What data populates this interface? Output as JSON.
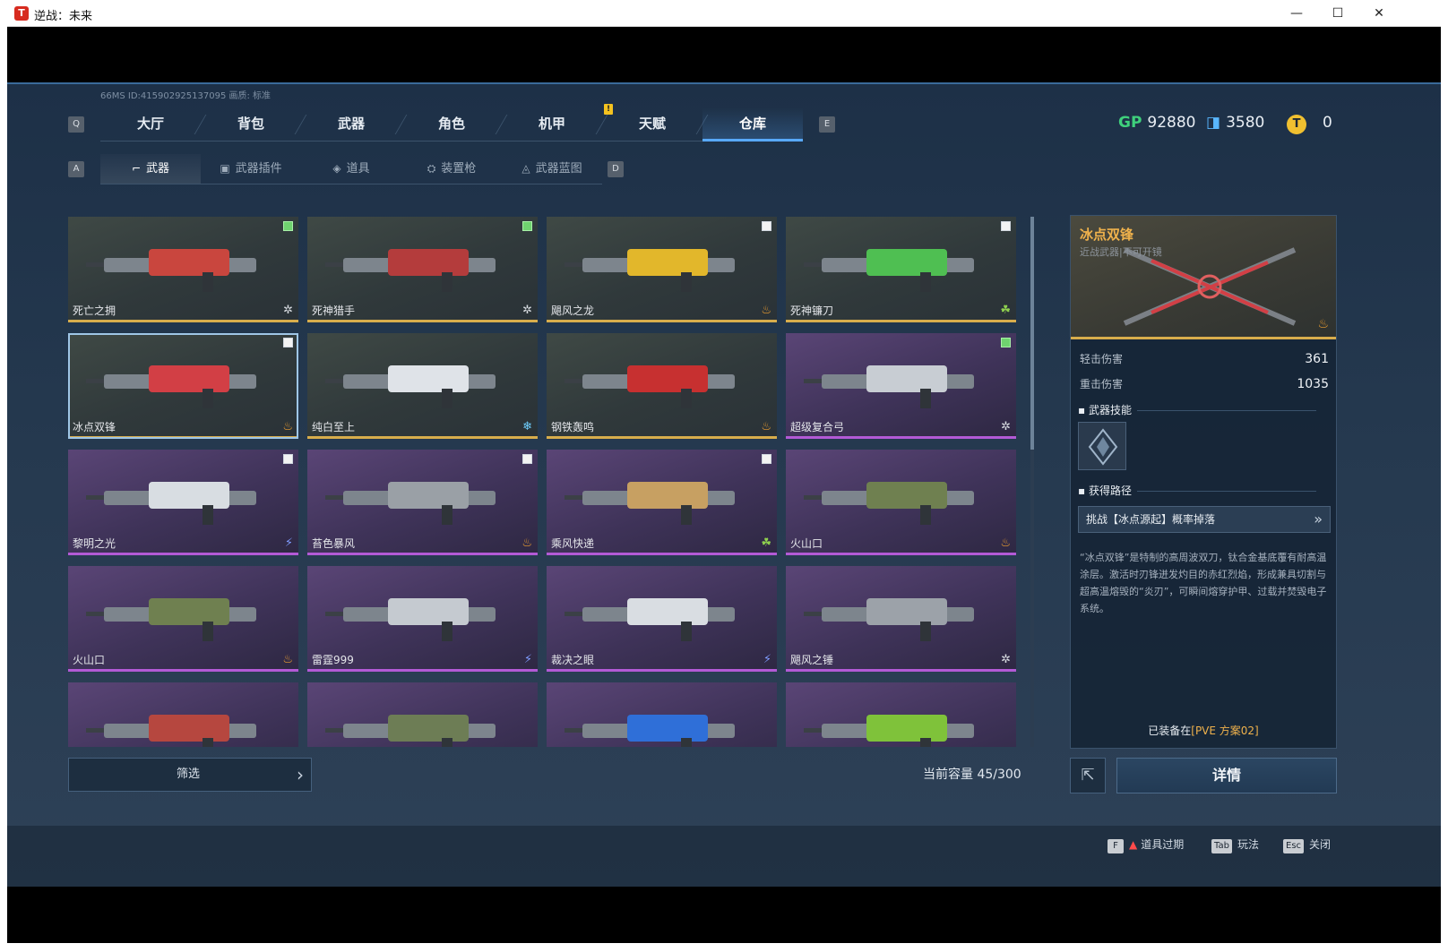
{
  "window": {
    "title": "逆战：未来",
    "app_icon": "T",
    "controls": [
      "—",
      "☐",
      "✕"
    ]
  },
  "info_line": "66MS  ID:415902925137095    画质: 标准",
  "keys": {
    "q": "Q",
    "e": "E",
    "a": "A",
    "d": "D"
  },
  "top_nav": {
    "items": [
      "大厅",
      "背包",
      "武器",
      "角色",
      "机甲",
      "天赋",
      "仓库"
    ],
    "active": "仓库",
    "badge": "!"
  },
  "sub_nav": {
    "items": [
      {
        "icon": "rifle-icon",
        "glyph": "⌐",
        "label": "武器"
      },
      {
        "icon": "plugin-icon",
        "glyph": "▣",
        "label": "武器插件"
      },
      {
        "icon": "item-icon",
        "glyph": "◈",
        "label": "道具"
      },
      {
        "icon": "turret-icon",
        "glyph": "⛭",
        "label": "装置枪"
      },
      {
        "icon": "blueprint-icon",
        "glyph": "◬",
        "label": "武器蓝图"
      }
    ],
    "active": "武器"
  },
  "currencies": [
    {
      "icon": "gp-icon",
      "symbol": "GP",
      "value": "92880",
      "color": "#3fd07c"
    },
    {
      "icon": "ticket-icon",
      "symbol": "◨",
      "value": "3580",
      "color": "#59b7ff"
    },
    {
      "icon": "coin-icon",
      "symbol": "T",
      "value": "0",
      "color": "#f0c030"
    }
  ],
  "weapons": [
    {
      "name": "死亡之拥",
      "rarity": "gold",
      "type_icon": "frost-icon",
      "type_glyph": "✲",
      "check": "green",
      "color": "#c9463e"
    },
    {
      "name": "死神猎手",
      "rarity": "gold",
      "type_icon": "frost-icon",
      "type_glyph": "✲",
      "check": "green",
      "color": "#b43c3c"
    },
    {
      "name": "飓风之龙",
      "rarity": "gold",
      "type_icon": "fire-icon",
      "type_glyph": "♨",
      "check": "white",
      "color": "#e2b72b"
    },
    {
      "name": "死神镰刀",
      "rarity": "gold",
      "type_icon": "poison-icon",
      "type_glyph": "☘",
      "check": "white",
      "color": "#4fbf52"
    },
    {
      "name": "冰点双锋",
      "rarity": "gold",
      "type_icon": "fire-icon",
      "type_glyph": "♨",
      "check": "white",
      "color": "#d23f45",
      "selected": true
    },
    {
      "name": "纯白至上",
      "rarity": "gold",
      "type_icon": "ice-icon",
      "type_glyph": "❄",
      "check": "none",
      "color": "#dfe3e8"
    },
    {
      "name": "钢铁轰鸣",
      "rarity": "gold",
      "type_icon": "fire-icon",
      "type_glyph": "♨",
      "check": "none",
      "color": "#c73030"
    },
    {
      "name": "超级复合弓",
      "rarity": "purple",
      "type_icon": "frost-icon",
      "type_glyph": "✲",
      "check": "green",
      "color": "#c8cdd3"
    },
    {
      "name": "黎明之光",
      "rarity": "purple",
      "type_icon": "lightning-icon",
      "type_glyph": "⚡",
      "check": "white",
      "color": "#d8dde2"
    },
    {
      "name": "苔色暴风",
      "rarity": "purple",
      "type_icon": "fire-icon",
      "type_glyph": "♨",
      "check": "white",
      "color": "#9aa0a6"
    },
    {
      "name": "乘风快递",
      "rarity": "purple",
      "type_icon": "poison-icon",
      "type_glyph": "☘",
      "check": "white",
      "color": "#c7a062"
    },
    {
      "name": "火山口",
      "rarity": "purple",
      "type_icon": "fire-icon",
      "type_glyph": "♨",
      "check": "none",
      "color": "#6f8050"
    },
    {
      "name": "火山口",
      "rarity": "purple",
      "type_icon": "fire-icon",
      "type_glyph": "♨",
      "check": "none",
      "color": "#6f8050"
    },
    {
      "name": "雷霆999",
      "rarity": "purple",
      "type_icon": "lightning-icon",
      "type_glyph": "⚡",
      "check": "none",
      "color": "#c5cad0"
    },
    {
      "name": "裁决之眼",
      "rarity": "purple",
      "type_icon": "lightning-icon",
      "type_glyph": "⚡",
      "check": "none",
      "color": "#d9dde2"
    },
    {
      "name": "飓风之锤",
      "rarity": "purple",
      "type_icon": "frost-icon",
      "type_glyph": "✲",
      "check": "none",
      "color": "#9ca2a9"
    },
    {
      "name": "",
      "rarity": "purple",
      "type_icon": "",
      "type_glyph": "",
      "check": "none",
      "color": "#b6473f"
    },
    {
      "name": "",
      "rarity": "purple",
      "type_icon": "",
      "type_glyph": "",
      "check": "none",
      "color": "#6d7d55"
    },
    {
      "name": "",
      "rarity": "purple",
      "type_icon": "",
      "type_glyph": "",
      "check": "none",
      "color": "#2f6fd8"
    },
    {
      "name": "",
      "rarity": "purple",
      "type_icon": "",
      "type_glyph": "",
      "check": "none",
      "color": "#7fc23a"
    }
  ],
  "filter": {
    "label": "筛选",
    "chevron": "›"
  },
  "capacity": "当前容量 45/300",
  "detail": {
    "name": "冰点双锋",
    "subtitle": "近战武器|不可开镜",
    "stats": [
      {
        "label": "轻击伤害",
        "value": "361"
      },
      {
        "label": "重击伤害",
        "value": "1035"
      }
    ],
    "skill_title": "武器技能",
    "route_title": "获得路径",
    "route": "挑战【冰点源起】概率掉落",
    "route_chevron": "»",
    "description": "“冰点双锋”是特制的高周波双刀，钛合金基底覆有耐高温涂层。激活时刃锋迸发灼目的赤红烈焰，形成兼具切割与超高温熔毁的“炎刃”，可瞬间熔穿护甲、过载并焚毁电子系统。",
    "equipped_prefix": "已装备在",
    "equipped_plan": "[PVE 方案02]"
  },
  "share_glyph": "⇱",
  "detail_button": "详情",
  "hints": [
    {
      "key": "F",
      "warn": "▲",
      "label": "道具过期"
    },
    {
      "key": "Tab",
      "warn": "",
      "label": "玩法"
    },
    {
      "key": "Esc",
      "warn": "",
      "label": "关闭"
    }
  ]
}
